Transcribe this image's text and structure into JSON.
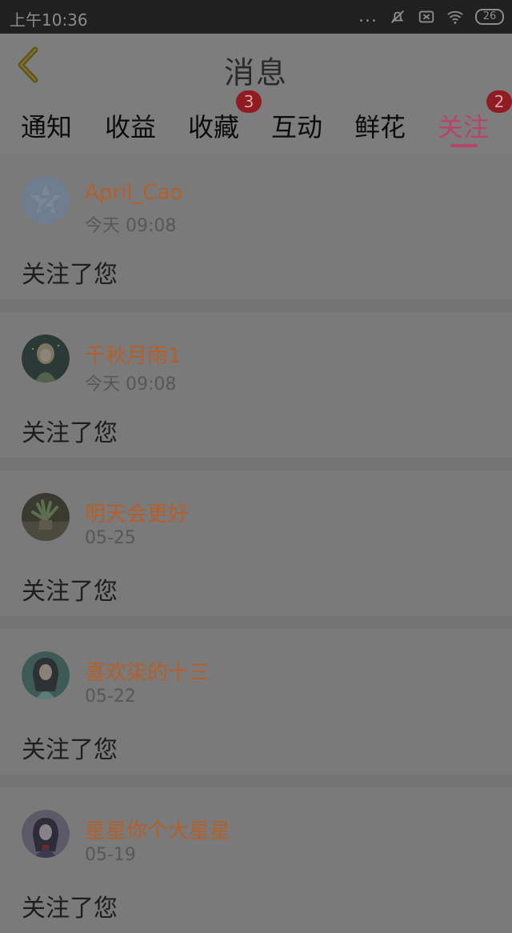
{
  "status_bar": {
    "time": "上午10:36",
    "dots": "...",
    "battery": "26"
  },
  "header": {
    "title": "消息"
  },
  "tabs": [
    {
      "label": "通知",
      "badge": ""
    },
    {
      "label": "收益",
      "badge": ""
    },
    {
      "label": "收藏",
      "badge": "3"
    },
    {
      "label": "互动",
      "badge": ""
    },
    {
      "label": "鲜花",
      "badge": ""
    },
    {
      "label": "关注",
      "badge": "2",
      "active": true
    }
  ],
  "messages": [
    {
      "name": "April_Cao",
      "time": "今天 09:08",
      "text": "关注了您",
      "avatar": "qq-default-avatar-icon"
    },
    {
      "name": "千秋月雨1",
      "time": "今天 09:08",
      "text": "关注了您",
      "avatar": "anime-girl-avatar"
    },
    {
      "name": "明天会更好",
      "time": "05-25",
      "text": "关注了您",
      "avatar": "plant-photo-avatar"
    },
    {
      "name": "喜欢柒的十三",
      "time": "05-22",
      "text": "关注了您",
      "avatar": "anime-girl-avatar"
    },
    {
      "name": "星星你个大星星",
      "time": "05-19",
      "text": "关注了您",
      "avatar": "anime-girl-avatar"
    }
  ],
  "colors": {
    "accent": "#b8436c",
    "name": "#b4602b",
    "badge": "#8e1c22"
  }
}
